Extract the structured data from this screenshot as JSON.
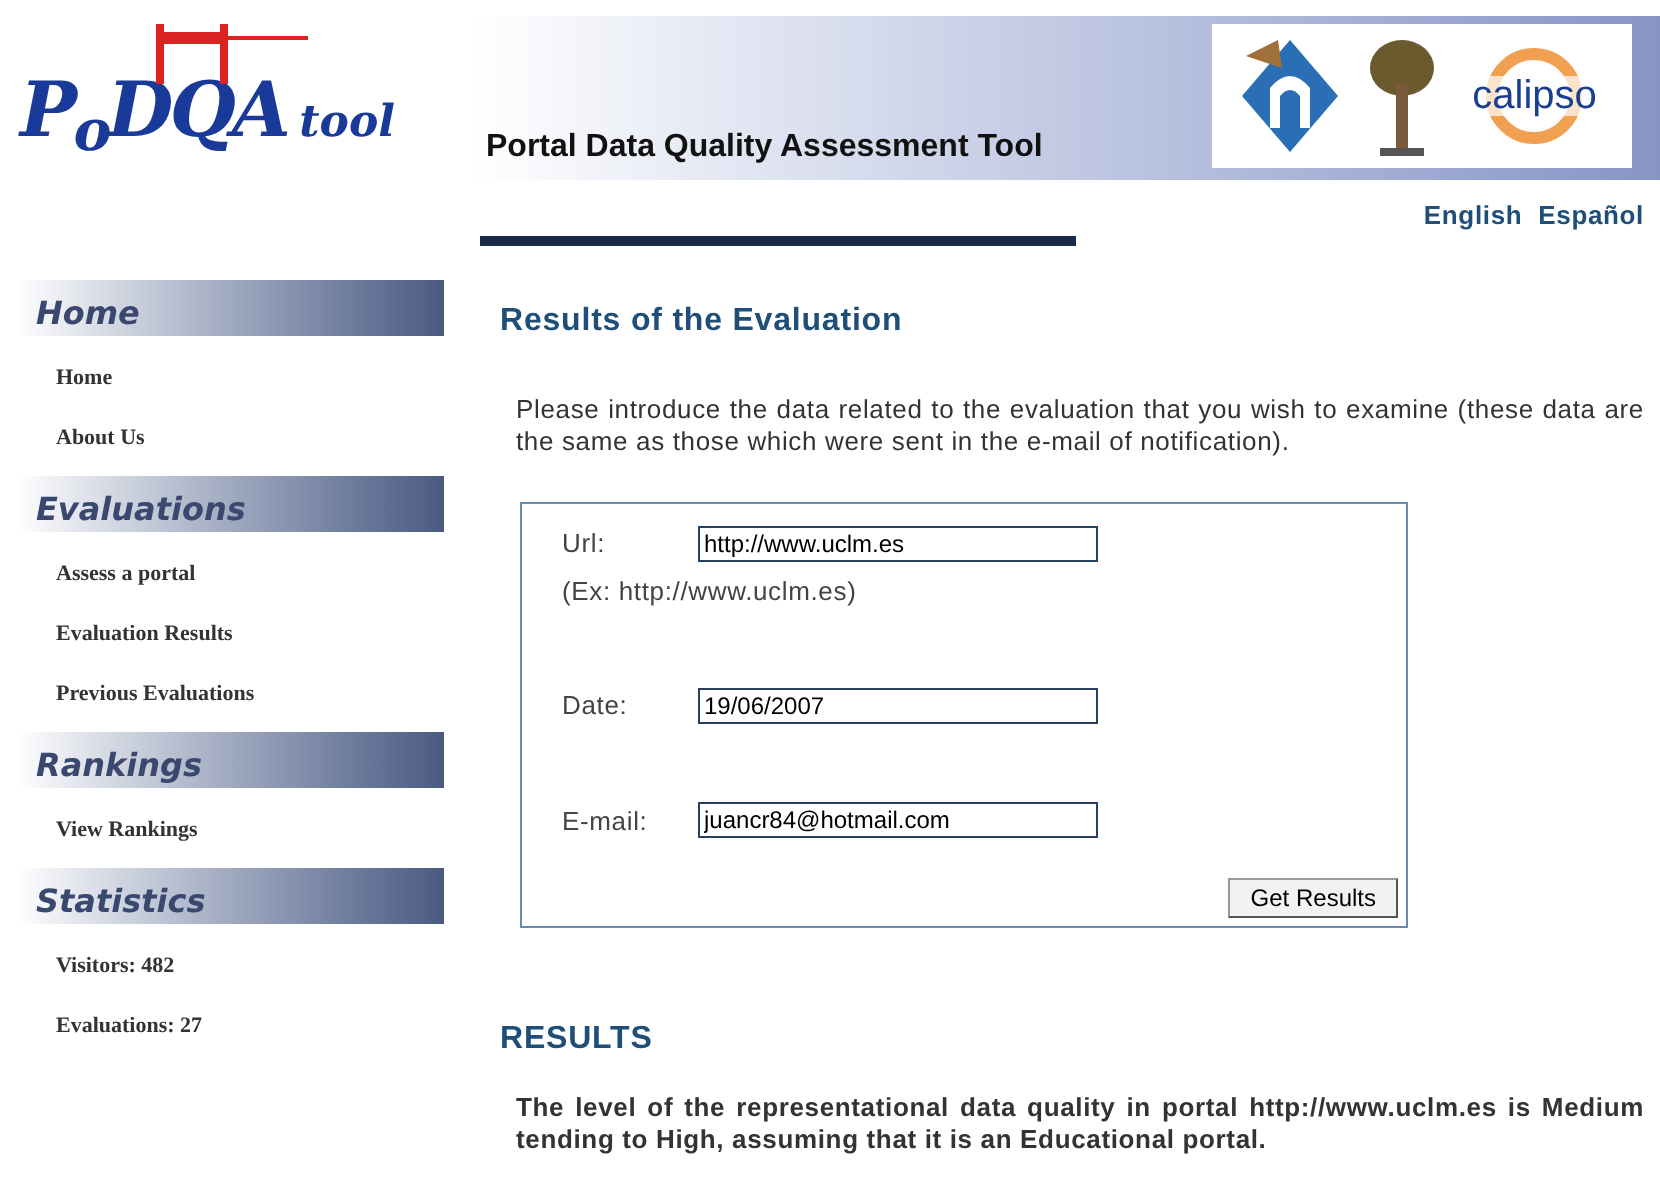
{
  "logo": {
    "name": "P$_{o}$DQA",
    "suffix": "tool"
  },
  "banner": {
    "title": "Portal Data Quality Assessment Tool",
    "partner": "calipso"
  },
  "languages": [
    {
      "label": "English"
    },
    {
      "label": "Español"
    }
  ],
  "sidebar": [
    {
      "heading": "Home",
      "items": [
        "Home",
        "About Us"
      ]
    },
    {
      "heading": "Evaluations",
      "items": [
        "Assess a portal",
        "Evaluation Results",
        "Previous Evaluations"
      ]
    },
    {
      "heading": "Rankings",
      "items": [
        "View Rankings"
      ]
    },
    {
      "heading": "Statistics",
      "items": [
        "Visitors: 482",
        "Evaluations: 27"
      ]
    }
  ],
  "main": {
    "title": "Results of the Evaluation",
    "intro": "Please introduce the data related to the evaluation that you wish to examine (these data are the same as those which were sent in the e-mail of notification).",
    "form": {
      "fields": [
        {
          "label": "Url:",
          "value": "http://www.uclm.es",
          "hint": "(Ex: http://www.uclm.es)"
        },
        {
          "label": "Date:",
          "value": "19/06/2007"
        },
        {
          "label": "E-mail:",
          "value": "juancr84@hotmail.com"
        }
      ],
      "button": "Get Results"
    },
    "results_heading": "RESULTS",
    "results_text": "The level of the representational data quality in portal http://www.uclm.es is Medium tending to High, assuming that it is an Educational portal."
  }
}
